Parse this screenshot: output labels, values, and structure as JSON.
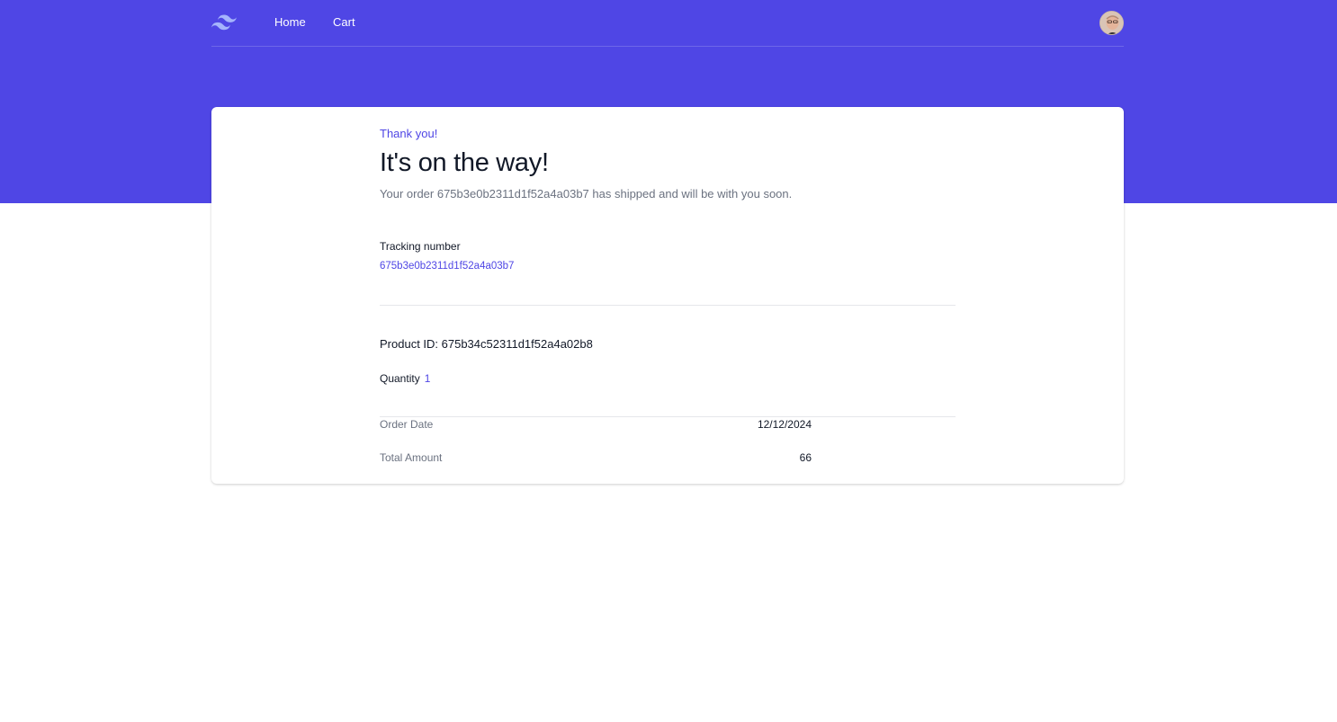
{
  "nav": {
    "logo_icon": "tailwind-logo-icon",
    "links": [
      {
        "label": "Home"
      },
      {
        "label": "Cart"
      }
    ],
    "avatar_icon": "user-avatar-icon"
  },
  "colors": {
    "brand": "#4f46e5",
    "text_primary": "#111827",
    "text_muted": "#6b7280",
    "divider": "#e5e7eb",
    "background": "#ffffff"
  },
  "order": {
    "eyebrow": "Thank you!",
    "title": "It's on the way!",
    "subtitle": "Your order 675b3e0b2311d1f52a4a03b7 has shipped and will be with you soon.",
    "tracking_label": "Tracking number",
    "tracking_value": "675b3e0b2311d1f52a4a03b7",
    "product_id": "Product ID: 675b34c52311d1f52a4a02b8",
    "quantity_label": "Quantity",
    "quantity_value": "1",
    "summary": [
      {
        "label": "Order Date",
        "value": "12/12/2024"
      },
      {
        "label": "Total Amount",
        "value": "66"
      }
    ]
  }
}
